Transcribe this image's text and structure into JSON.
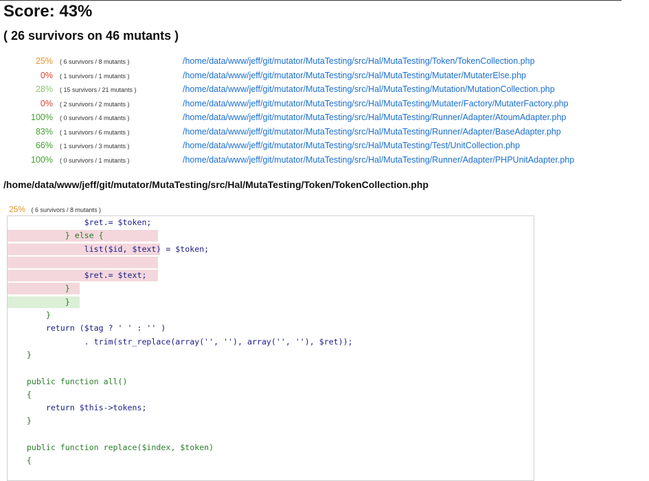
{
  "score": {
    "label": "Score: 43%",
    "summary": "( 26 survivors on 46 mutants )"
  },
  "colors": {
    "low": "#e03c2c",
    "midlow": "#e8912a",
    "mid": "#8ac46a",
    "high": "#3fa02a",
    "link": "#1a6fd0"
  },
  "files": [
    {
      "pct": "25%",
      "counts": "( 6 survivors / 8 mutants )",
      "path": "/home/data/www/jeff/git/mutator/MutaTesting/src/Hal/MutaTesting/Token/TokenCollection.php",
      "color": "#e8912a"
    },
    {
      "pct": "0%",
      "counts": "( 1 survivors / 1 mutants )",
      "path": "/home/data/www/jeff/git/mutator/MutaTesting/src/Hal/MutaTesting/Mutater/MutaterElse.php",
      "color": "#e03c2c"
    },
    {
      "pct": "28%",
      "counts": "( 15 survivors / 21 mutants )",
      "path": "/home/data/www/jeff/git/mutator/MutaTesting/src/Hal/MutaTesting/Mutation/MutationCollection.php",
      "color": "#8ac46a"
    },
    {
      "pct": "0%",
      "counts": "( 2 survivors / 2 mutants )",
      "path": "/home/data/www/jeff/git/mutator/MutaTesting/src/Hal/MutaTesting/Mutater/Factory/MutaterFactory.php",
      "color": "#e03c2c"
    },
    {
      "pct": "100%",
      "counts": "( 0 survivors / 4 mutants )",
      "path": "/home/data/www/jeff/git/mutator/MutaTesting/src/Hal/MutaTesting/Runner/Adapter/AtoumAdapter.php",
      "color": "#3fa02a"
    },
    {
      "pct": "83%",
      "counts": "( 1 survivors / 6 mutants )",
      "path": "/home/data/www/jeff/git/mutator/MutaTesting/src/Hal/MutaTesting/Runner/Adapter/BaseAdapter.php",
      "color": "#3fa02a"
    },
    {
      "pct": "66%",
      "counts": "( 1 survivors / 3 mutants )",
      "path": "/home/data/www/jeff/git/mutator/MutaTesting/src/Hal/MutaTesting/Test/UnitCollection.php",
      "color": "#3fa02a"
    },
    {
      "pct": "100%",
      "counts": "( 0 survivors / 1 mutants )",
      "path": "/home/data/www/jeff/git/mutator/MutaTesting/src/Hal/MutaTesting/Runner/Adapter/PHPUnitAdapter.php",
      "color": "#3fa02a"
    }
  ],
  "detail": {
    "title": "/home/data/www/jeff/git/mutator/MutaTesting/src/Hal/MutaTesting/Token/TokenCollection.php",
    "pct": "25%",
    "counts": "( 6 survivors / 8 mutants )"
  },
  "code": {
    "lines": [
      "                $ret.= $token;",
      "            } else {",
      "                list($id, $text) = $token;",
      "",
      "                $ret.= $text;",
      "            }",
      "            }",
      "        }",
      "        return ($tag ? ' ' : '' )",
      "                . trim(str_replace(array('', ''), array('', ''), $ret));",
      "    }",
      "",
      "    public function all()",
      "    {",
      "        return $this->tokens;",
      "    }",
      "",
      "    public function replace($index, $token)",
      "    {"
    ]
  }
}
